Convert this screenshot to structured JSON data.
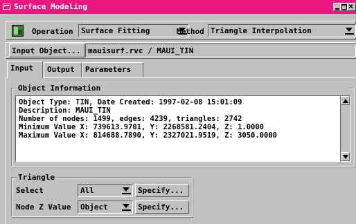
{
  "window": {
    "title": "Surface Modeling"
  },
  "toolbar": {
    "operation_label": "Operation",
    "operation_value": "Surface Fitting",
    "method_label": "Method",
    "method_value": "Triangle Interpolation"
  },
  "input_object": {
    "button_label": "Input Object...",
    "path": "mauisurf.rvc / MAUI_TIN"
  },
  "tabs": [
    {
      "label": "Input",
      "active": true
    },
    {
      "label": "Output",
      "active": false
    },
    {
      "label": "Parameters",
      "active": false
    }
  ],
  "object_information": {
    "legend": "Object Information",
    "lines": [
      "Object Type: TIN, Date Created: 1997-02-08 15:01:09",
      "Description: MAUI_TIN",
      "Number of nodes: 1499, edges: 4239, triangles: 2742",
      "Minimum Value X: 739613.9701, Y: 2268581.2404, Z: 1.0000",
      "Maximum Value X: 814688.7890, Y: 2327021.9519, Z: 3050.0000"
    ]
  },
  "triangle": {
    "legend": "Triangle",
    "select_label": "Select",
    "select_value": "All",
    "node_z_label": "Node Z Value",
    "node_z_value": "Object",
    "specify_label": "Specify..."
  },
  "colors": {
    "title_bar": "#e8187e",
    "window_bg": "#c0c0c0"
  }
}
